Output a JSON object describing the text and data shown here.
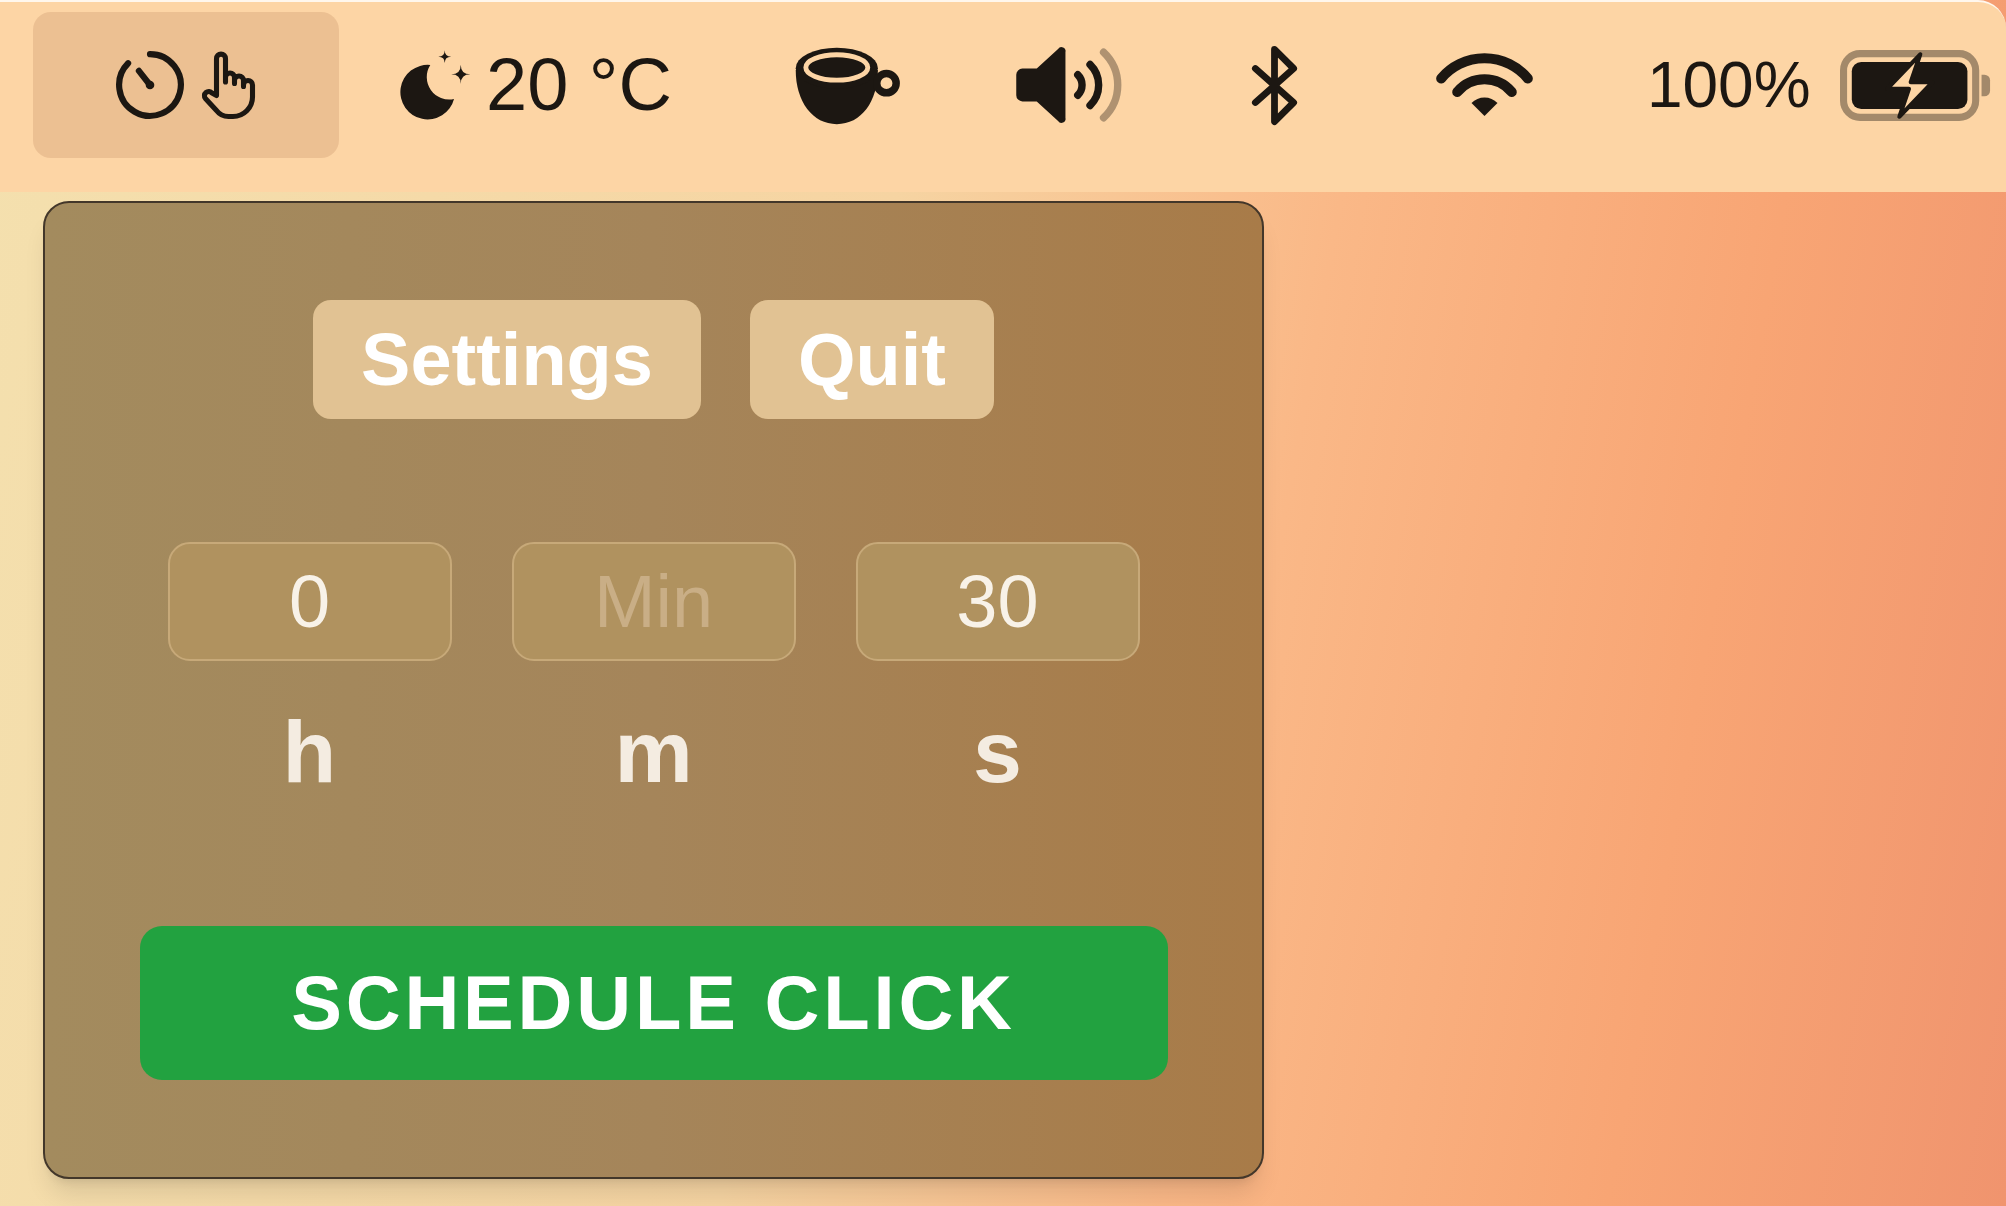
{
  "menu_bar": {
    "items": [
      {
        "kind": "app",
        "selected": true
      },
      {
        "kind": "weather",
        "text": "20 °C",
        "selected": false
      },
      {
        "kind": "coffee",
        "selected": false
      },
      {
        "kind": "volume",
        "selected": false
      },
      {
        "kind": "bluetooth",
        "selected": false
      },
      {
        "kind": "wifi",
        "selected": false
      },
      {
        "kind": "battery",
        "text": "100%",
        "selected": false
      }
    ]
  },
  "popover": {
    "buttons": [
      {
        "label": "Settings"
      },
      {
        "label": "Quit"
      }
    ],
    "fields": [
      {
        "value": "0",
        "unit": "h"
      },
      {
        "placeholder": "Min",
        "unit": "m"
      },
      {
        "value": "30",
        "unit": "s"
      }
    ],
    "primary_button": {
      "label": "SCHEDULE CLICK"
    }
  }
}
